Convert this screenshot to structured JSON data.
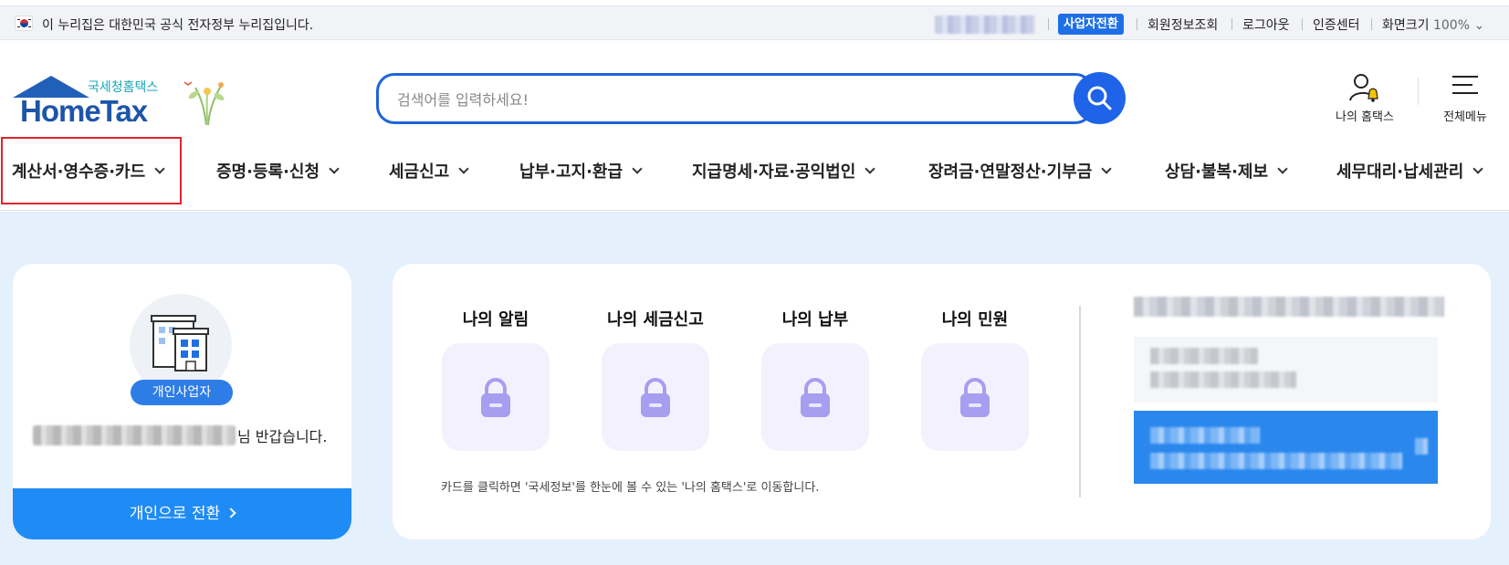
{
  "gov_bar": {
    "notice": "이 누리집은 대한민국 공식 전자정부 누리집입니다.",
    "biz_switch": "사업자전환",
    "links": [
      "회원정보조회",
      "로그아웃",
      "인증센터"
    ],
    "zoom_label": "화면크기",
    "zoom_value": "100%"
  },
  "header": {
    "logo_ko": "국세청홈택스",
    "logo_en": "HomeTax",
    "search_placeholder": "검색어를 입력하세요!",
    "my_hometax": "나의 홈택스",
    "all_menu": "전체메뉴"
  },
  "nav": {
    "items": [
      "계산서·영수증·카드",
      "증명·등록·신청",
      "세금신고",
      "납부·고지·환급",
      "지급명세·자료·공익법인",
      "장려금·연말정산·기부금",
      "상담·불복·제보",
      "세무대리·납세관리"
    ],
    "highlighted_index": 0
  },
  "profile": {
    "badge": "개인사업자",
    "greeting_suffix": "님 반갑습니다.",
    "switch_button": "개인으로 전환"
  },
  "dashboard": {
    "tiles": [
      "나의 알림",
      "나의 세금신고",
      "나의 납부",
      "나의 민원"
    ],
    "note": "카드를 클릭하면 '국세정보'를 한눈에 볼 수 있는 '나의 홈택스'로 이동합니다."
  },
  "colors": {
    "primary": "#1f63e8",
    "highlight_border": "#e2232a",
    "main_background": "#e4f0fb",
    "switch_button": "#1f8bf5",
    "tile_background": "#f3f1fd",
    "lock_icon": "#a79ef0"
  }
}
